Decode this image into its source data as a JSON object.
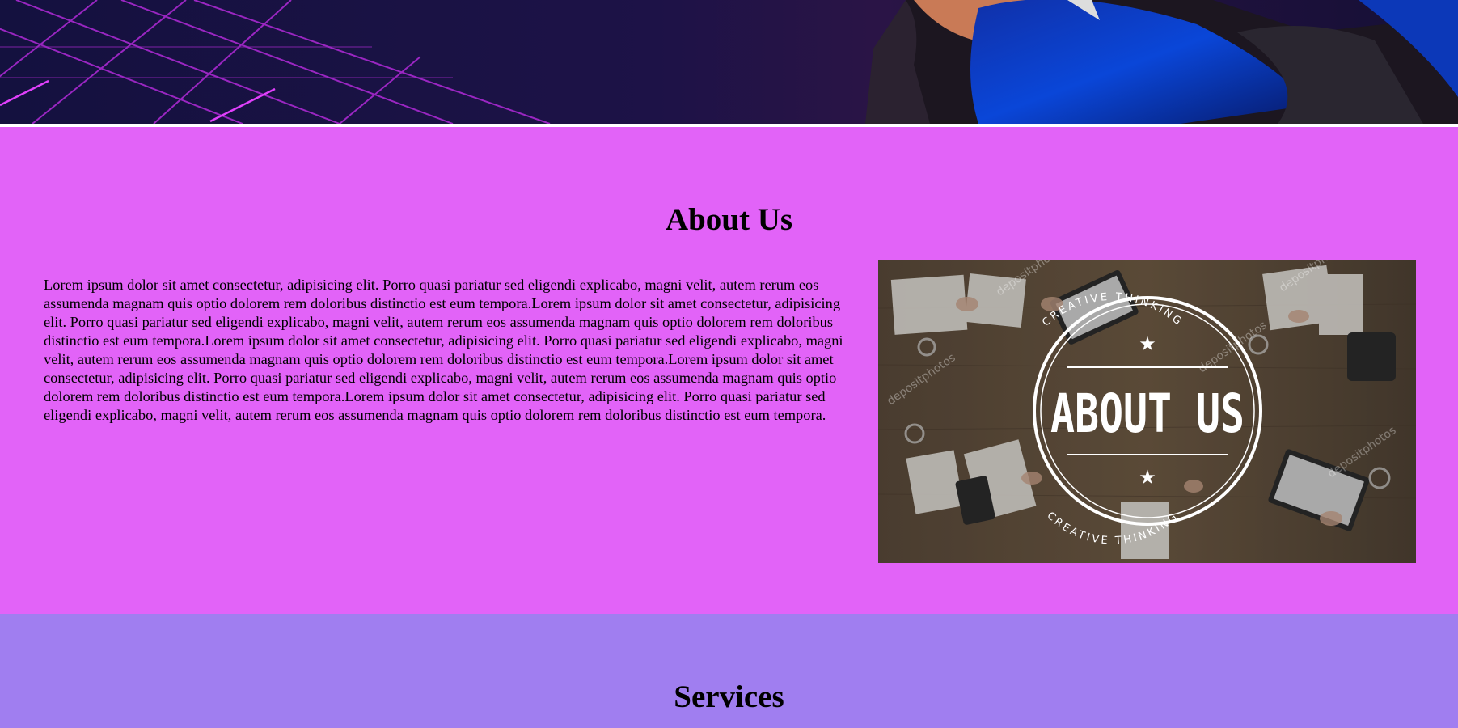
{
  "about": {
    "title": "About Us",
    "paragraph": "Lorem ipsum dolor sit amet consectetur, adipisicing elit. Porro quasi pariatur sed eligendi explicabo, magni velit, autem rerum eos assumenda magnam quis optio dolorem rem doloribus distinctio est eum tempora.Lorem ipsum dolor sit amet consectetur, adipisicing elit. Porro quasi pariatur sed eligendi explicabo, magni velit, autem rerum eos assumenda magnam quis optio dolorem rem doloribus distinctio est eum tempora.Lorem ipsum dolor sit amet consectetur, adipisicing elit. Porro quasi pariatur sed eligendi explicabo, magni velit, autem rerum eos assumenda magnam quis optio dolorem rem doloribus distinctio est eum tempora.Lorem ipsum dolor sit amet consectetur, adipisicing elit. Porro quasi pariatur sed eligendi explicabo, magni velit, autem rerum eos assumenda magnam quis optio dolorem rem doloribus distinctio est eum tempora.Lorem ipsum dolor sit amet consectetur, adipisicing elit. Porro quasi pariatur sed eligendi explicabo, magni velit, autem rerum eos assumenda magnam quis optio dolorem rem doloribus distinctio est eum tempora.",
    "image": {
      "badge_main": "ABOUT US",
      "badge_top": "CREATIVE THINKING",
      "badge_bottom": "CREATIVE THINKING",
      "watermark": "depositphotos"
    }
  },
  "services": {
    "title": "Services"
  },
  "colors": {
    "about_bg": "#e263f8",
    "services_bg": "#a07ef0",
    "hero_bg": "#1a1245",
    "hero_grid": "#b12ad8"
  }
}
